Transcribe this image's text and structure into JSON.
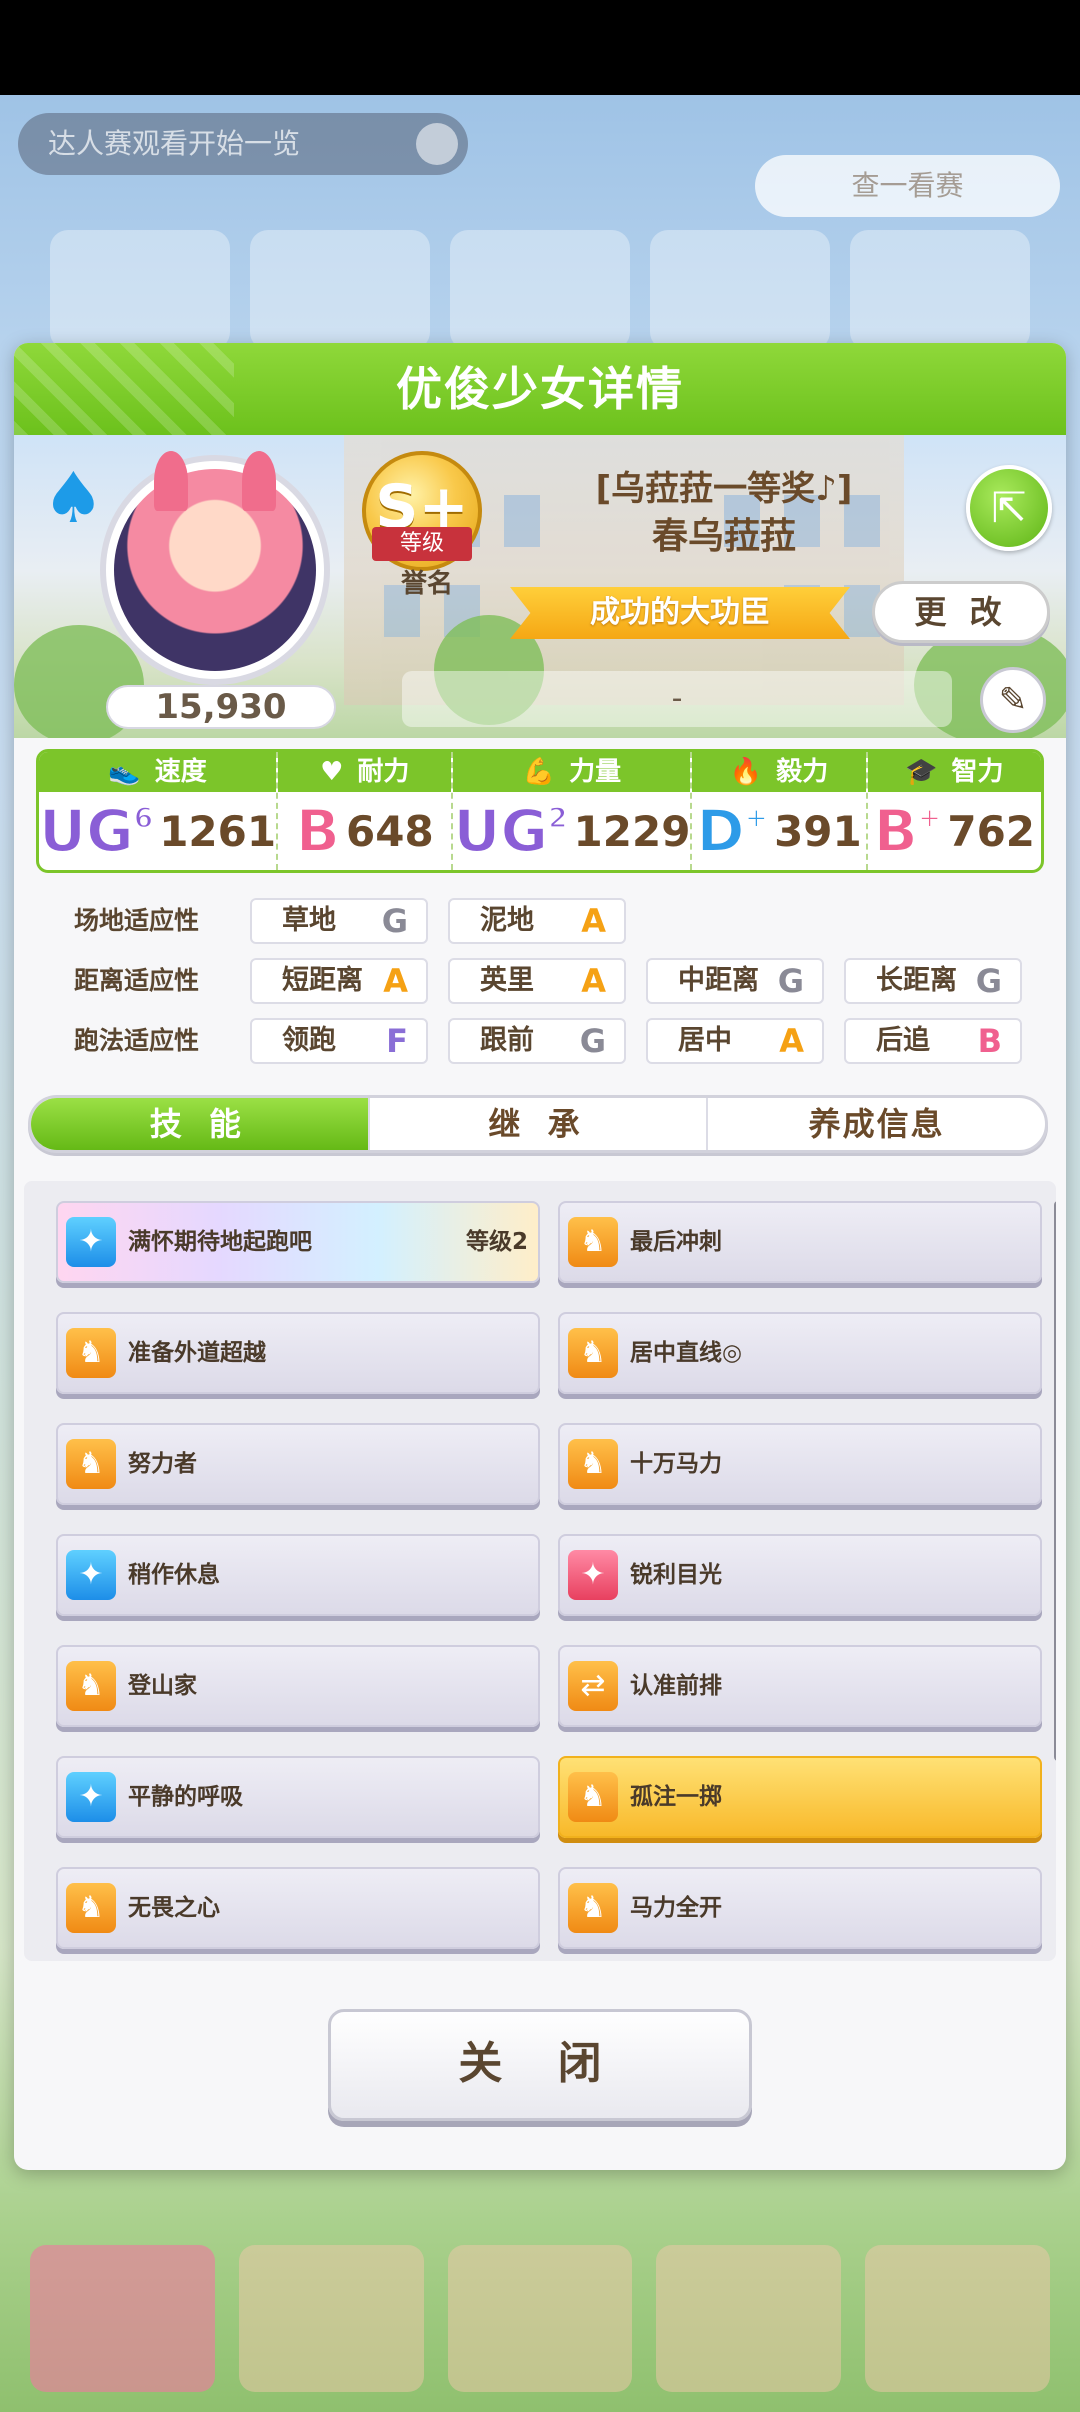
{
  "background": {
    "top_pill_text": "达人赛观看开始一览",
    "top_button_text": "查一看赛"
  },
  "dialog": {
    "title": "优俊少女详情"
  },
  "profile": {
    "fans": "15,930",
    "rank_letter": "S+",
    "rank_ribbon": "等级",
    "rank_label": "誉名",
    "title": "[乌菈菈一等奖♪]",
    "name": "春乌菈菈",
    "epithet": "成功的大功臣",
    "change_button": "更 改",
    "memo": "-"
  },
  "stats": [
    {
      "label": "速度",
      "icon": "shoe-icon",
      "grade": "UG",
      "grade_sub": "6",
      "value": "1261"
    },
    {
      "label": "耐力",
      "icon": "heart-icon",
      "grade": "B",
      "grade_sub": "",
      "value": "648"
    },
    {
      "label": "力量",
      "icon": "muscle-icon",
      "grade": "UG",
      "grade_sub": "2",
      "value": "1229"
    },
    {
      "label": "毅力",
      "icon": "flame-icon",
      "grade": "D",
      "grade_sub": "+",
      "value": "391"
    },
    {
      "label": "智力",
      "icon": "graduation-cap-icon",
      "grade": "B",
      "grade_sub": "+",
      "value": "762"
    }
  ],
  "aptitude": {
    "track": {
      "label": "场地适应性",
      "items": [
        {
          "name": "草地",
          "grade": "G"
        },
        {
          "name": "泥地",
          "grade": "A"
        }
      ]
    },
    "distance": {
      "label": "距离适应性",
      "items": [
        {
          "name": "短距离",
          "grade": "A"
        },
        {
          "name": "英里",
          "grade": "A"
        },
        {
          "name": "中距离",
          "grade": "G"
        },
        {
          "name": "长距离",
          "grade": "G"
        }
      ]
    },
    "style": {
      "label": "跑法适应性",
      "items": [
        {
          "name": "领跑",
          "grade": "F"
        },
        {
          "name": "跟前",
          "grade": "G"
        },
        {
          "name": "居中",
          "grade": "A"
        },
        {
          "name": "后追",
          "grade": "B"
        }
      ]
    }
  },
  "tabs": [
    "技 能",
    "继 承",
    "养成信息"
  ],
  "skills": [
    {
      "name": "满怀期待地起跑吧",
      "level": "等级2",
      "icon": "sparkle-icon",
      "style": "rainbow"
    },
    {
      "name": "最后冲刺",
      "level": "",
      "icon": "horse-run-icon",
      "style": "normal"
    },
    {
      "name": "准备外道超越",
      "level": "",
      "icon": "horse-run-icon",
      "style": "normal"
    },
    {
      "name": "居中直线◎",
      "level": "",
      "icon": "horse-run-icon",
      "style": "normal"
    },
    {
      "name": "努力者",
      "level": "",
      "icon": "horse-run-icon",
      "style": "normal"
    },
    {
      "name": "十万马力",
      "level": "",
      "icon": "horse-run-icon",
      "style": "normal"
    },
    {
      "name": "稍作休息",
      "level": "",
      "icon": "sparkle-icon",
      "style": "normal"
    },
    {
      "name": "锐利目光",
      "level": "",
      "icon": "sparkle-red-icon",
      "style": "normal"
    },
    {
      "name": "登山家",
      "level": "",
      "icon": "horse-run-icon",
      "style": "normal"
    },
    {
      "name": "认准前排",
      "level": "",
      "icon": "swap-arrows-icon",
      "style": "normal"
    },
    {
      "name": "平静的呼吸",
      "level": "",
      "icon": "sparkle-icon",
      "style": "normal"
    },
    {
      "name": "孤注一掷",
      "level": "",
      "icon": "horse-run-icon",
      "style": "gold"
    },
    {
      "name": "无畏之心",
      "level": "",
      "icon": "horse-run-icon",
      "style": "normal"
    },
    {
      "name": "马力全开",
      "level": "",
      "icon": "horse-run-icon",
      "style": "normal"
    }
  ],
  "close_button": "关 闭"
}
